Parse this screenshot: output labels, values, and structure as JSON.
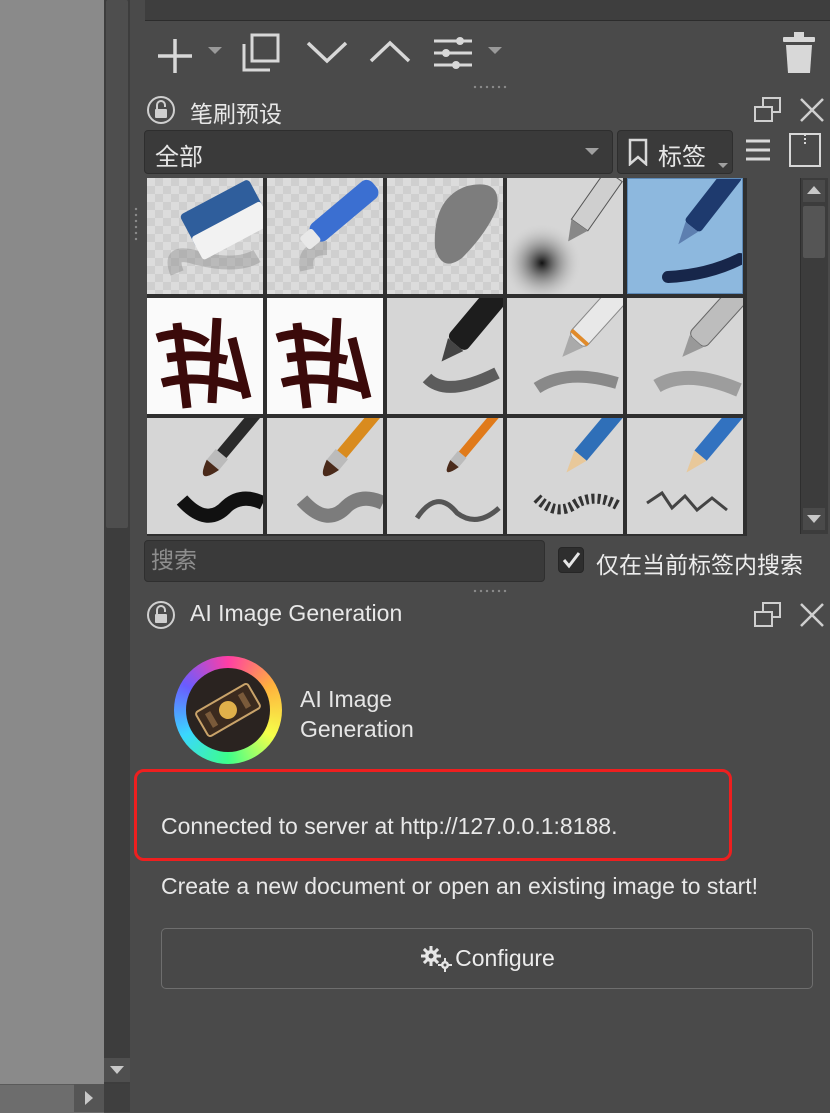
{
  "layers_toolbar": {
    "icons": [
      "add-icon",
      "duplicate-icon",
      "move-down-icon",
      "move-up-icon",
      "properties-icon",
      "delete-icon"
    ]
  },
  "brush_presets": {
    "title": "笔刷预设",
    "filter_value": "全部",
    "tag_label": "标签",
    "search_placeholder": "搜索",
    "search_in_tag_label": "仅在当前标签内搜索",
    "search_in_tag_checked": true,
    "brushes": [
      "eraser",
      "blue-eraser-pen",
      "smudge-blob",
      "airbrush",
      "ink-pen-selected",
      "calligraphy-1",
      "calligraphy-2",
      "marker-black",
      "pen-orange-ring",
      "pen-grey",
      "brush-dark",
      "brush-orange",
      "brush-thin",
      "pencil-blue",
      "pencil-blue-2"
    ]
  },
  "ai_panel": {
    "title": "AI Image Generation",
    "plugin_name": "AI Image Generation",
    "status": "Connected to server at http://127.0.0.1:8188.",
    "hint": "Create a new document or open an existing image to start!",
    "configure_label": "Configure",
    "highlight_color": "#ee1f1f"
  }
}
